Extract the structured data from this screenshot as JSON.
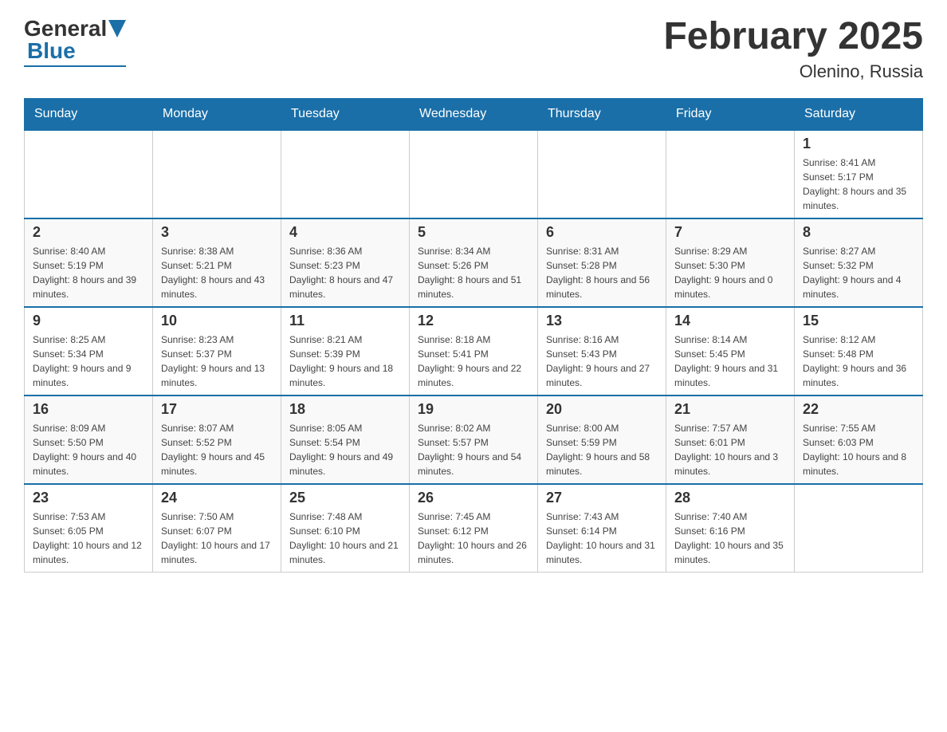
{
  "logo": {
    "general": "General",
    "blue": "Blue"
  },
  "title": "February 2025",
  "location": "Olenino, Russia",
  "weekdays": [
    "Sunday",
    "Monday",
    "Tuesday",
    "Wednesday",
    "Thursday",
    "Friday",
    "Saturday"
  ],
  "weeks": [
    [
      {
        "day": "",
        "sunrise": "",
        "sunset": "",
        "daylight": ""
      },
      {
        "day": "",
        "sunrise": "",
        "sunset": "",
        "daylight": ""
      },
      {
        "day": "",
        "sunrise": "",
        "sunset": "",
        "daylight": ""
      },
      {
        "day": "",
        "sunrise": "",
        "sunset": "",
        "daylight": ""
      },
      {
        "day": "",
        "sunrise": "",
        "sunset": "",
        "daylight": ""
      },
      {
        "day": "",
        "sunrise": "",
        "sunset": "",
        "daylight": ""
      },
      {
        "day": "1",
        "sunrise": "Sunrise: 8:41 AM",
        "sunset": "Sunset: 5:17 PM",
        "daylight": "Daylight: 8 hours and 35 minutes."
      }
    ],
    [
      {
        "day": "2",
        "sunrise": "Sunrise: 8:40 AM",
        "sunset": "Sunset: 5:19 PM",
        "daylight": "Daylight: 8 hours and 39 minutes."
      },
      {
        "day": "3",
        "sunrise": "Sunrise: 8:38 AM",
        "sunset": "Sunset: 5:21 PM",
        "daylight": "Daylight: 8 hours and 43 minutes."
      },
      {
        "day": "4",
        "sunrise": "Sunrise: 8:36 AM",
        "sunset": "Sunset: 5:23 PM",
        "daylight": "Daylight: 8 hours and 47 minutes."
      },
      {
        "day": "5",
        "sunrise": "Sunrise: 8:34 AM",
        "sunset": "Sunset: 5:26 PM",
        "daylight": "Daylight: 8 hours and 51 minutes."
      },
      {
        "day": "6",
        "sunrise": "Sunrise: 8:31 AM",
        "sunset": "Sunset: 5:28 PM",
        "daylight": "Daylight: 8 hours and 56 minutes."
      },
      {
        "day": "7",
        "sunrise": "Sunrise: 8:29 AM",
        "sunset": "Sunset: 5:30 PM",
        "daylight": "Daylight: 9 hours and 0 minutes."
      },
      {
        "day": "8",
        "sunrise": "Sunrise: 8:27 AM",
        "sunset": "Sunset: 5:32 PM",
        "daylight": "Daylight: 9 hours and 4 minutes."
      }
    ],
    [
      {
        "day": "9",
        "sunrise": "Sunrise: 8:25 AM",
        "sunset": "Sunset: 5:34 PM",
        "daylight": "Daylight: 9 hours and 9 minutes."
      },
      {
        "day": "10",
        "sunrise": "Sunrise: 8:23 AM",
        "sunset": "Sunset: 5:37 PM",
        "daylight": "Daylight: 9 hours and 13 minutes."
      },
      {
        "day": "11",
        "sunrise": "Sunrise: 8:21 AM",
        "sunset": "Sunset: 5:39 PM",
        "daylight": "Daylight: 9 hours and 18 minutes."
      },
      {
        "day": "12",
        "sunrise": "Sunrise: 8:18 AM",
        "sunset": "Sunset: 5:41 PM",
        "daylight": "Daylight: 9 hours and 22 minutes."
      },
      {
        "day": "13",
        "sunrise": "Sunrise: 8:16 AM",
        "sunset": "Sunset: 5:43 PM",
        "daylight": "Daylight: 9 hours and 27 minutes."
      },
      {
        "day": "14",
        "sunrise": "Sunrise: 8:14 AM",
        "sunset": "Sunset: 5:45 PM",
        "daylight": "Daylight: 9 hours and 31 minutes."
      },
      {
        "day": "15",
        "sunrise": "Sunrise: 8:12 AM",
        "sunset": "Sunset: 5:48 PM",
        "daylight": "Daylight: 9 hours and 36 minutes."
      }
    ],
    [
      {
        "day": "16",
        "sunrise": "Sunrise: 8:09 AM",
        "sunset": "Sunset: 5:50 PM",
        "daylight": "Daylight: 9 hours and 40 minutes."
      },
      {
        "day": "17",
        "sunrise": "Sunrise: 8:07 AM",
        "sunset": "Sunset: 5:52 PM",
        "daylight": "Daylight: 9 hours and 45 minutes."
      },
      {
        "day": "18",
        "sunrise": "Sunrise: 8:05 AM",
        "sunset": "Sunset: 5:54 PM",
        "daylight": "Daylight: 9 hours and 49 minutes."
      },
      {
        "day": "19",
        "sunrise": "Sunrise: 8:02 AM",
        "sunset": "Sunset: 5:57 PM",
        "daylight": "Daylight: 9 hours and 54 minutes."
      },
      {
        "day": "20",
        "sunrise": "Sunrise: 8:00 AM",
        "sunset": "Sunset: 5:59 PM",
        "daylight": "Daylight: 9 hours and 58 minutes."
      },
      {
        "day": "21",
        "sunrise": "Sunrise: 7:57 AM",
        "sunset": "Sunset: 6:01 PM",
        "daylight": "Daylight: 10 hours and 3 minutes."
      },
      {
        "day": "22",
        "sunrise": "Sunrise: 7:55 AM",
        "sunset": "Sunset: 6:03 PM",
        "daylight": "Daylight: 10 hours and 8 minutes."
      }
    ],
    [
      {
        "day": "23",
        "sunrise": "Sunrise: 7:53 AM",
        "sunset": "Sunset: 6:05 PM",
        "daylight": "Daylight: 10 hours and 12 minutes."
      },
      {
        "day": "24",
        "sunrise": "Sunrise: 7:50 AM",
        "sunset": "Sunset: 6:07 PM",
        "daylight": "Daylight: 10 hours and 17 minutes."
      },
      {
        "day": "25",
        "sunrise": "Sunrise: 7:48 AM",
        "sunset": "Sunset: 6:10 PM",
        "daylight": "Daylight: 10 hours and 21 minutes."
      },
      {
        "day": "26",
        "sunrise": "Sunrise: 7:45 AM",
        "sunset": "Sunset: 6:12 PM",
        "daylight": "Daylight: 10 hours and 26 minutes."
      },
      {
        "day": "27",
        "sunrise": "Sunrise: 7:43 AM",
        "sunset": "Sunset: 6:14 PM",
        "daylight": "Daylight: 10 hours and 31 minutes."
      },
      {
        "day": "28",
        "sunrise": "Sunrise: 7:40 AM",
        "sunset": "Sunset: 6:16 PM",
        "daylight": "Daylight: 10 hours and 35 minutes."
      },
      {
        "day": "",
        "sunrise": "",
        "sunset": "",
        "daylight": ""
      }
    ]
  ]
}
